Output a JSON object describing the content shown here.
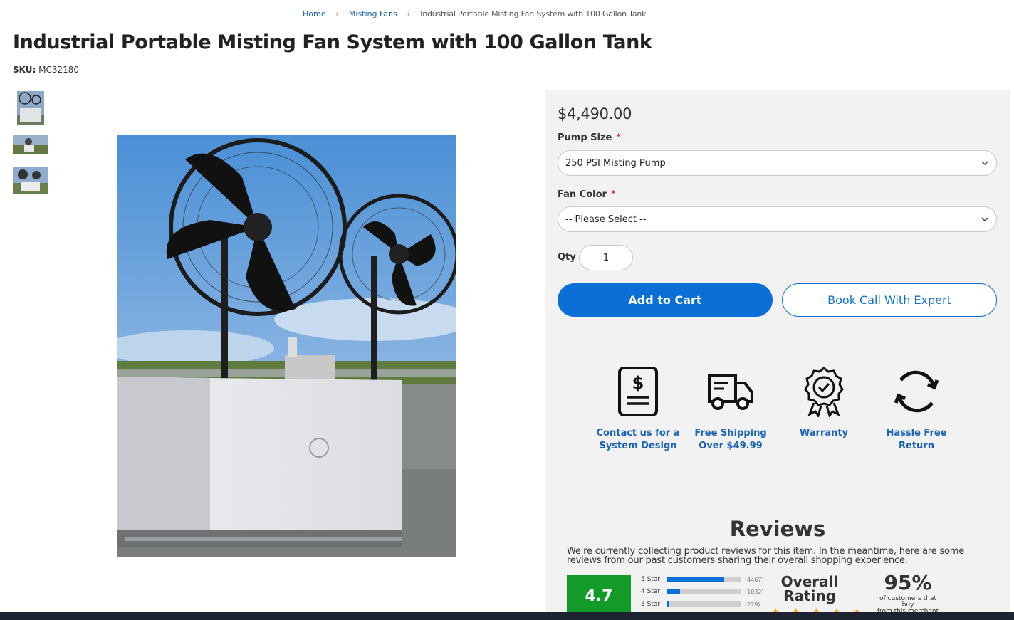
{
  "breadcrumb": {
    "home": "Home",
    "category": "Misting Fans",
    "current": "Industrial Portable Misting Fan System with 100 Gallon Tank"
  },
  "product": {
    "title": "Industrial Portable Misting Fan System with 100 Gallon Tank",
    "sku_label": "SKU:",
    "sku_value": "MC32180",
    "price": "$4,490.00"
  },
  "options": {
    "pump_label": "Pump Size",
    "pump_value": "250 PSI Misting Pump",
    "color_label": "Fan Color",
    "color_value": "-- Please Select --",
    "required_mark": "*"
  },
  "qty": {
    "label": "Qty",
    "value": "1"
  },
  "buttons": {
    "add_to_cart": "Add to Cart",
    "book_call": "Book Call With Expert"
  },
  "features": [
    {
      "line1": "Contact us for a",
      "line2": "System Design",
      "icon": "invoice-dollar-icon"
    },
    {
      "line1": "Free Shipping",
      "line2": "Over $49.99",
      "icon": "delivery-truck-icon"
    },
    {
      "line1": "Warranty",
      "line2": "",
      "icon": "award-badge-icon"
    },
    {
      "line1": "Hassle Free",
      "line2": "Return",
      "icon": "refresh-arrows-icon"
    }
  ],
  "reviews": {
    "title": "Reviews",
    "text": "We're currently collecting product reviews for this item. In the meantime, here are some reviews from our past customers sharing their overall shopping experience.",
    "score": "4.7",
    "bars": [
      {
        "label": "5 Star",
        "count": "(4467)",
        "fraction": 0.78
      },
      {
        "label": "4 Star",
        "count": "(1032)",
        "fraction": 0.18
      },
      {
        "label": "3 Star",
        "count": "(229)",
        "fraction": 0.03
      }
    ],
    "overall_line1": "Overall",
    "overall_line2": "Rating",
    "stars": "★★★★★",
    "percent": "95%",
    "percent_sub1": "of customers that",
    "percent_sub2": "buy",
    "percent_sub3": "from this merchant"
  },
  "colors": {
    "accent": "#0a6fd6",
    "link": "#1a63b8",
    "score_green": "#139b2a",
    "panel_bg": "#f2f2f2",
    "required": "#d0021b"
  }
}
